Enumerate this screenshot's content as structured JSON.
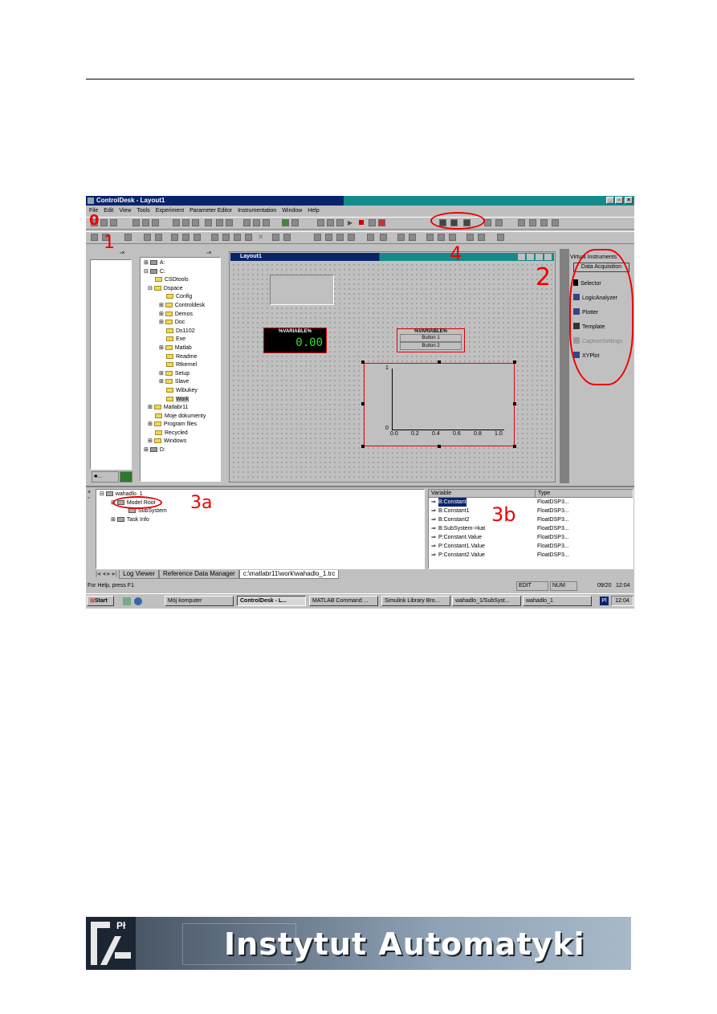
{
  "window": {
    "title": "ControlDesk - Layout1",
    "menu": [
      "File",
      "Edit",
      "View",
      "Tools",
      "Experiment",
      "Parameter Editor",
      "Instrumentation",
      "Window",
      "Help"
    ]
  },
  "tree_c": {
    "items": [
      "A:",
      "C:",
      "CSDtools",
      "Dspace",
      "Config",
      "Controldesk",
      "Demos",
      "Doc",
      "Ds1102",
      "Exe",
      "Matlab",
      "Readme",
      "Rtkernel",
      "Setup",
      "Slave",
      "Wibukey",
      "Work",
      "Matlabr11",
      "Moje dokumenty",
      "Program files",
      "Recycled",
      "Windows",
      "D:"
    ]
  },
  "layout": {
    "title": "Layout1",
    "display_label": "%VARIABLE%",
    "display_value": "0.00",
    "radio_label": "%VARIABLE%",
    "button1": "Button 1",
    "button2": "Button 2",
    "plot_y_top": "1",
    "plot_y_bottom": "0",
    "plot_x_ticks": [
      "0.0",
      "0.2",
      "0.4",
      "0.6",
      "0.8",
      "1.0"
    ]
  },
  "vi": {
    "header": "Virtual Instruments",
    "tab": "Data Acquisition",
    "items": [
      "Selector",
      "LogicAnalyzer",
      "Plotter",
      "Template",
      "CaptureSettings",
      "XYPlot"
    ]
  },
  "model_tree": {
    "items": [
      "wahadlo_1",
      "Model Root",
      "SubSystem",
      "Task Info"
    ]
  },
  "variables": {
    "col_variable": "Variable",
    "col_type": "Type",
    "rows": [
      {
        "name": "B:Constant",
        "type": "FloatDSP3..."
      },
      {
        "name": "B:Constant1",
        "type": "FloatDSP3..."
      },
      {
        "name": "B:Constant2",
        "type": "FloatDSP3..."
      },
      {
        "name": "B:SubSystem->kat",
        "type": "FloatDSP3..."
      },
      {
        "name": "P:Constant.Value",
        "type": "FloatDSP3..."
      },
      {
        "name": "P:Constant1.Value",
        "type": "FloatDSP3..."
      },
      {
        "name": "P:Constant2.Value",
        "type": "FloatDSP3..."
      }
    ]
  },
  "tabs": [
    "Log Viewer",
    "Reference Data Manager",
    "c:\\matlabr11\\work\\wahadlo_1.trc"
  ],
  "status": {
    "help": "For Help, press F1",
    "mode": "EDIT",
    "num": "NUM",
    "date": "09/20",
    "time": "12:04"
  },
  "taskbar": {
    "start": "Start",
    "buttons": [
      "Mój komputer",
      "ControlDesk - L...",
      "MATLAB Command ...",
      "Simulink Library Bro...",
      "wahadlo_1/SubSyst...",
      "wahadlo_1"
    ],
    "clock": "12:04",
    "lang": "Pl"
  },
  "annotations": [
    "0",
    "1",
    "4",
    "2",
    "3a",
    "3b"
  ],
  "banner": {
    "title": "Instytut Automatyki",
    "logo_text": "Pł"
  },
  "colors": {
    "title_active": "#0a246a",
    "title_teal": "#158a8a",
    "annotation_red": "#e00000"
  }
}
